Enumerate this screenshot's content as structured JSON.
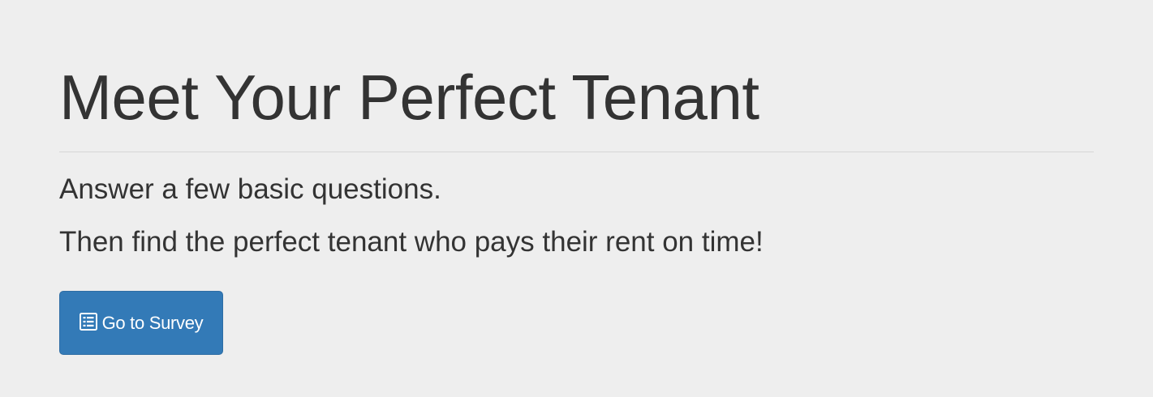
{
  "hero": {
    "title": "Meet Your Perfect Tenant",
    "lead_1": "Answer a few basic questions.",
    "lead_2": "Then find the perfect tenant who pays their rent on time!",
    "cta": {
      "label": "Go to Survey",
      "icon": "list-alt-icon"
    }
  },
  "colors": {
    "background": "#eeeeee",
    "text": "#333333",
    "button": "#337ab7",
    "button_text": "#ffffff"
  }
}
